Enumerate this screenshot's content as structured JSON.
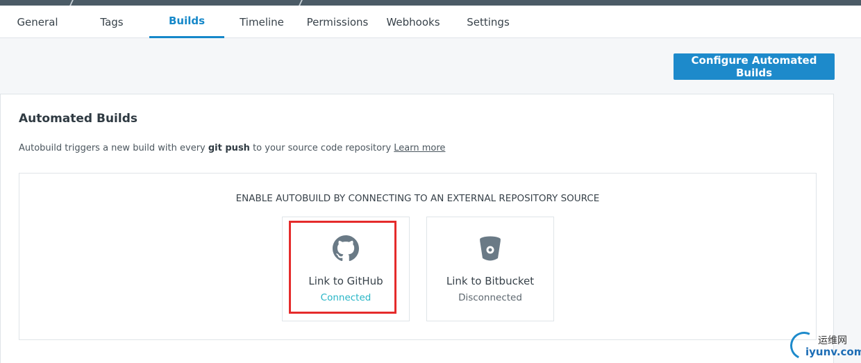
{
  "tabs": [
    {
      "label": "General",
      "active": false
    },
    {
      "label": "Tags",
      "active": false
    },
    {
      "label": "Builds",
      "active": true
    },
    {
      "label": "Timeline",
      "active": false
    },
    {
      "label": "Permissions",
      "active": false
    },
    {
      "label": "Webhooks",
      "active": false
    },
    {
      "label": "Settings",
      "active": false
    }
  ],
  "actions": {
    "configure_label": "Configure Automated Builds"
  },
  "panel": {
    "title": "Automated Builds",
    "desc_prefix": "Autobuild triggers a new build with every ",
    "desc_bold": "git push",
    "desc_suffix": " to your source code repository ",
    "learn_more": "Learn more",
    "heading": "ENABLE AUTOBUILD BY CONNECTING TO AN EXTERNAL REPOSITORY SOURCE"
  },
  "sources": {
    "github": {
      "label": "Link to GitHub",
      "status": "Connected",
      "icon": "github-icon"
    },
    "bitbucket": {
      "label": "Link to Bitbucket",
      "status": "Disconnected",
      "icon": "bitbucket-icon"
    }
  },
  "watermark": {
    "line1": "运维网",
    "line2": "iyunv.com"
  },
  "colors": {
    "accent": "#1d8acb",
    "connected": "#27b5c6",
    "highlight": "#e52b2b"
  }
}
